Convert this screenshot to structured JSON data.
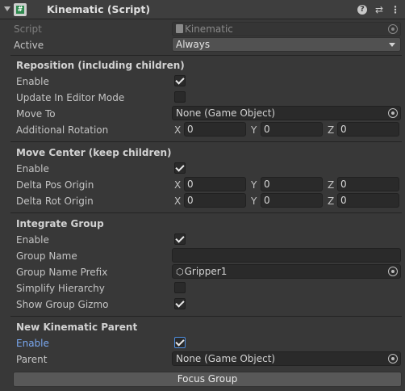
{
  "header": {
    "title": "Kinematic (Script)",
    "script_glyph": "#",
    "help_icon": "question-icon",
    "presets_icon": "sliders-icon",
    "menu_icon": "kebab-icon"
  },
  "script": {
    "label": "Script",
    "value": "Kinematic"
  },
  "active": {
    "label": "Active",
    "value": "Always"
  },
  "reposition": {
    "title": "Reposition (including children)",
    "enable": {
      "label": "Enable",
      "checked": true
    },
    "update_editor": {
      "label": "Update In Editor Mode",
      "checked": false
    },
    "move_to": {
      "label": "Move To",
      "value": "None (Game Object)"
    },
    "rotation": {
      "label": "Additional Rotation",
      "x_label": "X",
      "y_label": "Y",
      "z_label": "Z",
      "x": "0",
      "y": "0",
      "z": "0"
    }
  },
  "move_center": {
    "title": "Move Center (keep children)",
    "enable": {
      "label": "Enable",
      "checked": true
    },
    "pos_origin": {
      "label": "Delta Pos Origin",
      "x_label": "X",
      "y_label": "Y",
      "z_label": "Z",
      "x": "0",
      "y": "0",
      "z": "0"
    },
    "rot_origin": {
      "label": "Delta Rot Origin",
      "x_label": "X",
      "y_label": "Y",
      "z_label": "Z",
      "x": "0",
      "y": "0",
      "z": "0"
    }
  },
  "integrate": {
    "title": "Integrate Group",
    "enable": {
      "label": "Enable",
      "checked": true
    },
    "group_name": {
      "label": "Group Name",
      "value": ""
    },
    "group_prefix": {
      "label": "Group Name Prefix",
      "value": "Gripper1"
    },
    "simplify": {
      "label": "Simplify Hierarchy",
      "checked": false
    },
    "gizmo": {
      "label": "Show Group Gizmo",
      "checked": true
    }
  },
  "parent_section": {
    "title": "New Kinematic Parent",
    "enable": {
      "label": "Enable",
      "checked": true
    },
    "parent": {
      "label": "Parent",
      "value": "None (Game Object)"
    }
  },
  "focus_button": "Focus Group",
  "colors": {
    "background": "#383838",
    "field": "#2a2a2a",
    "focus": "#4e8edf",
    "label_active": "#7aa8f0"
  }
}
